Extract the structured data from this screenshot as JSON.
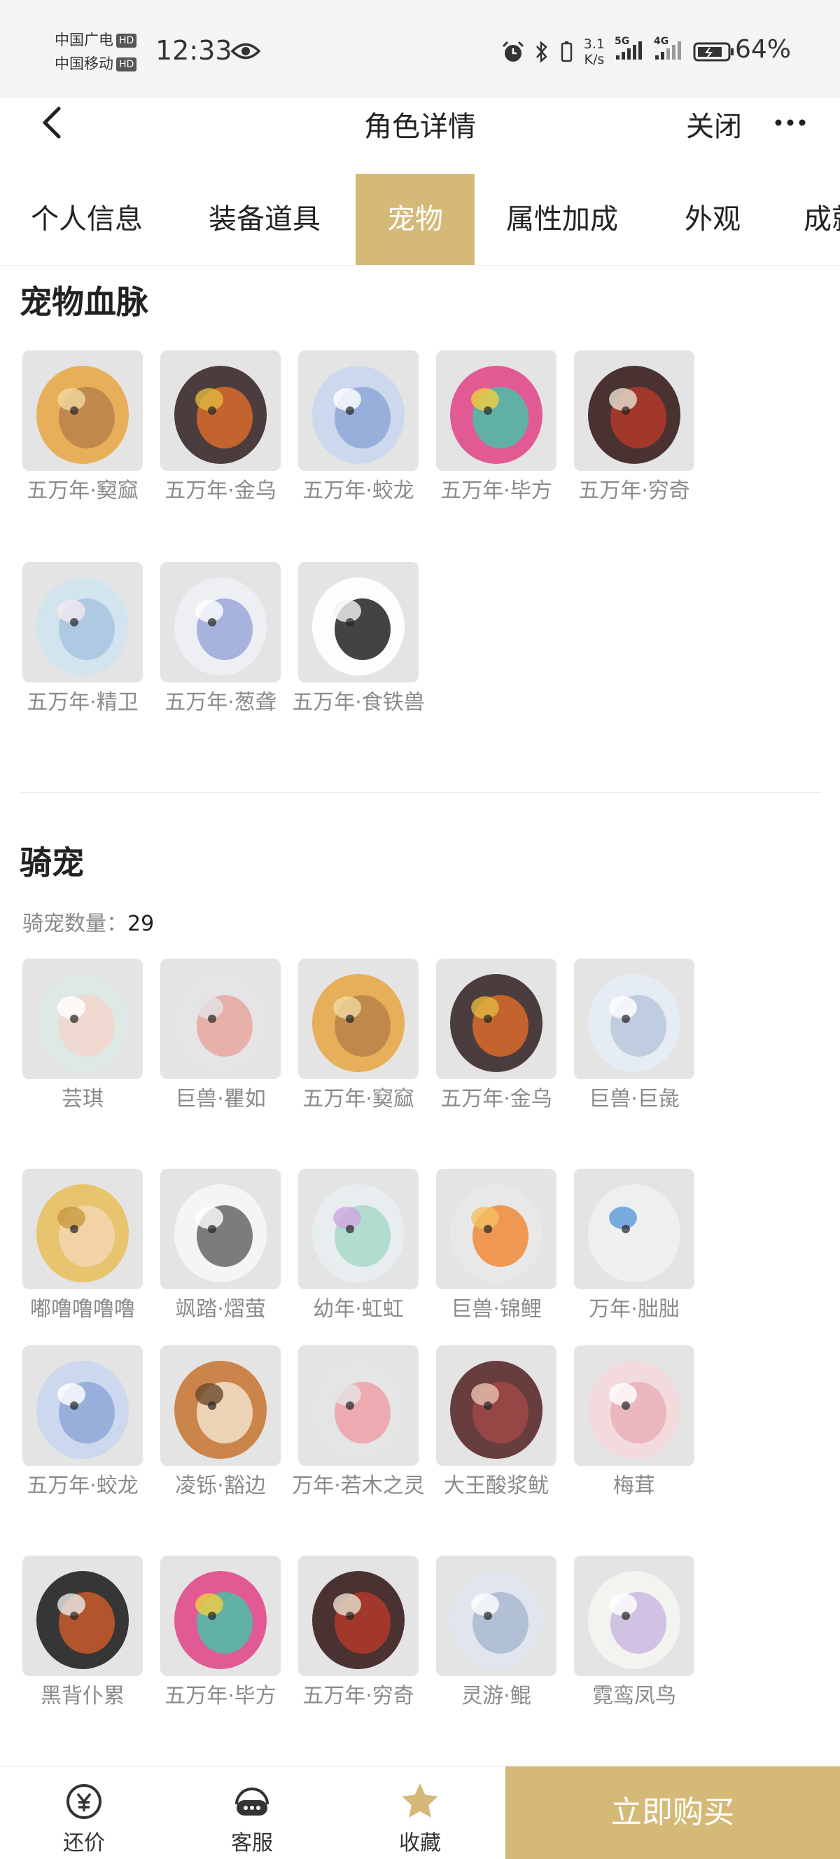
{
  "status_bar": {
    "carrier1": "中国广电",
    "carrier2": "中国移动",
    "hd": "HD",
    "time": "12:33",
    "net_speed_value": "3.1",
    "net_speed_unit": "K/s",
    "signal1": "5G",
    "signal2": "4G",
    "battery": "64%"
  },
  "nav": {
    "title": "角色详情",
    "close": "关闭"
  },
  "tabs": [
    "个人信息",
    "装备道具",
    "宠物",
    "属性加成",
    "外观",
    "成就"
  ],
  "active_tab": "宠物",
  "sections": {
    "bloodline": {
      "title": "宠物血脉",
      "items": [
        {
          "name": "五万年·窫窳",
          "icon": "horned-beast-portrait"
        },
        {
          "name": "五万年·金乌",
          "icon": "dark-bird-portrait"
        },
        {
          "name": "五万年·蛟龙",
          "icon": "blue-dragon-portrait"
        },
        {
          "name": "五万年·毕方",
          "icon": "crane-bird-portrait"
        },
        {
          "name": "五万年·穷奇",
          "icon": "red-beast-portrait"
        },
        {
          "name": "五万年·精卫",
          "icon": "fairy-girl-portrait"
        },
        {
          "name": "五万年·葱聋",
          "icon": "white-beast-portrait"
        },
        {
          "name": "五万年·食铁兽",
          "icon": "panda-portrait"
        }
      ]
    },
    "mounts": {
      "title": "骑宠",
      "count_label": "骑宠数量：",
      "count": "29",
      "items": [
        {
          "name": "芸琪",
          "icon": "doll-girl-portrait"
        },
        {
          "name": "巨兽·瞿如",
          "icon": "pink-claw-portrait"
        },
        {
          "name": "五万年·窫窳",
          "icon": "horned-beast-portrait"
        },
        {
          "name": "五万年·金乌",
          "icon": "dark-bird-portrait"
        },
        {
          "name": "巨兽·巨彘",
          "icon": "white-boar-portrait"
        },
        {
          "name": "嘟噜噜噜噜",
          "icon": "golden-girl-portrait"
        },
        {
          "name": "飒踏·熠萤",
          "icon": "white-fluff-portrait"
        },
        {
          "name": "幼年·虹虹",
          "icon": "crystal-fish-portrait"
        },
        {
          "name": "巨兽·锦鲤",
          "icon": "koi-portrait"
        },
        {
          "name": "万年·朏朏",
          "icon": "white-cat-portrait"
        },
        {
          "name": "五万年·蛟龙",
          "icon": "blue-dragon-portrait"
        },
        {
          "name": "凌铄·豁边",
          "icon": "fox-portrait"
        },
        {
          "name": "万年·若木之灵",
          "icon": "lotus-portrait"
        },
        {
          "name": "大王酸浆鱿",
          "icon": "squid-portrait"
        },
        {
          "name": "梅茸",
          "icon": "pink-elf-portrait"
        },
        {
          "name": "黑背仆累",
          "icon": "black-beetle-portrait"
        },
        {
          "name": "五万年·毕方",
          "icon": "crane-bird-portrait"
        },
        {
          "name": "五万年·穷奇",
          "icon": "red-beast-portrait"
        },
        {
          "name": "灵游·鲲",
          "icon": "silver-fish-portrait"
        },
        {
          "name": "霓鸾凤鸟",
          "icon": "fluffy-bird-portrait"
        }
      ]
    }
  },
  "bottom_bar": {
    "bargain": "还价",
    "service": "客服",
    "favorite": "收藏",
    "buy": "立即购买"
  },
  "colors": {
    "accent": "#d5b976",
    "label_gray": "#8a8a8a"
  }
}
